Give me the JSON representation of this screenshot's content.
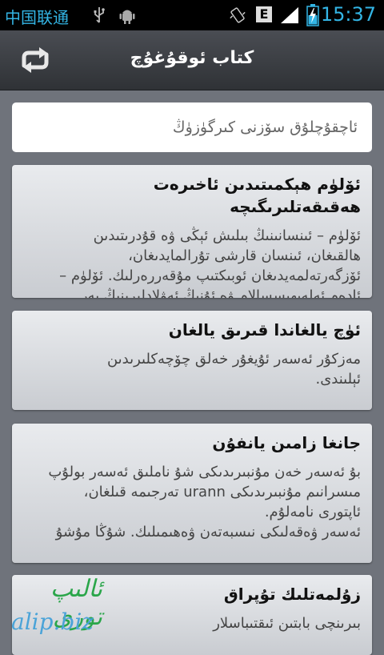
{
  "status_bar": {
    "carrier": "中国联通",
    "network_badge": "E",
    "time": "15:37",
    "icons": [
      "usb-icon",
      "android-debug-icon",
      "vibrate-icon",
      "signal-icon",
      "battery-charging-icon"
    ]
  },
  "header": {
    "title": "كتاب ئوقۇغۇچ",
    "back_icon": "return-arrow-icon"
  },
  "search": {
    "placeholder": "ئاچقۇچلۇق سۆزنى كىرگۈزۈڭ"
  },
  "cards": [
    {
      "title": "ئۆلۈم ھېكمىتىدىن ئاخىرەت ھەقىقەتلىرىگىچە",
      "body": "ئۆلۈم – ئىنسانىنىڭ بىلىش ئېڭى ۋە قۇدرىتىدىن\nھالقىغان، ئىنسان قارشى تۇرالمايدىغان،\nئۆزگەرتەلمەيدىغان ئوبىكتىپ مۇقەررەرلىك. ئۆلۈم –\nئادەم ئەلەيھىسسالام ۋە ئۇنىڭ ئەۋلادلىرىنىڭ يەر"
    },
    {
      "title": "ئۈچ يالغاندا قىرىق يالغان",
      "body": "مەزكۇر ئەسەر ئۇيغۇر خەلق چۆچەكلىرىدىن\nئېلىندى."
    },
    {
      "title": "جانغا زامىن يانفۇن",
      "body": "بۇ ئەسەر خەن مۇنبىرىدىكى شۇ ناملىق ئەسەر بولۇپ\nمىسرانىم مۇنبىرىدىكى urann تەرجىمە قىلغان،\nئاپتورى نامەلۇم.\nئەسەر ۋەقەلىكى نىسبەتەن ۋەھىمىلىك. شۇڭا مۇشۇ"
    },
    {
      "title": "زۇلمەتلىك تۇپراق",
      "body": "بىرىنچى بابتىن ئىقتىباسلار"
    }
  ],
  "watermark": {
    "line1": "ئالىپ تورى",
    "line2": "alip.biz"
  }
}
